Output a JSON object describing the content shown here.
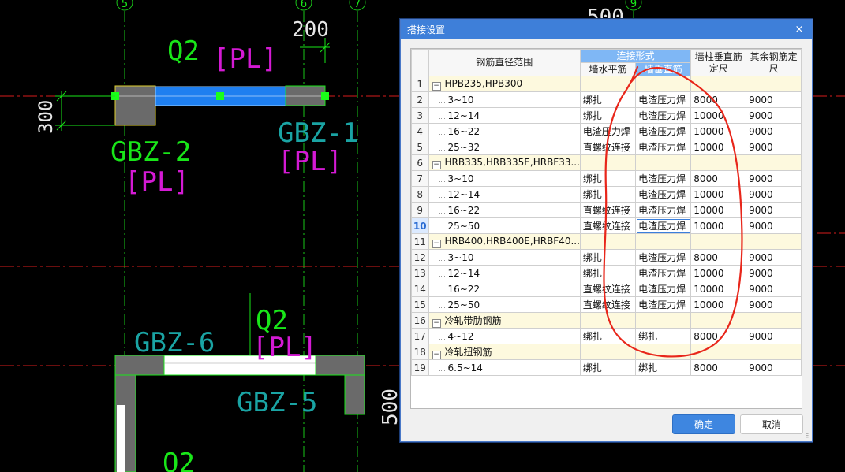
{
  "cad": {
    "axis_labels": [
      "5",
      "6",
      "7",
      "9"
    ],
    "labels": {
      "q2_top": "Q2",
      "pl_top": "[PL]",
      "dim_200": "200",
      "dim_300": "300",
      "gbz2": "GBZ-2",
      "gbz2_pl": "[PL]",
      "gbz1": "GBZ-1",
      "gbz1_pl": "[PL]",
      "dim_500_top": "500",
      "q2_mid": "Q2",
      "pl_mid": "[PL]",
      "gbz6": "GBZ-6",
      "gbz5": "GBZ-5",
      "dim_500_right": "500",
      "q2_bottom": "Q2"
    }
  },
  "dialog": {
    "title": "搭接设置",
    "close_label": "×",
    "headers": {
      "range": "钢筋直径范围",
      "connection": "连接形式",
      "wall_horizontal": "墙水平筋",
      "wall_vertical": "墙垂直筋",
      "column_length_1": "墙柱垂直筋",
      "column_length_2": "定尺",
      "other_length_1": "其余钢筋定",
      "other_length_2": "尺"
    },
    "rows": [
      {
        "n": "1",
        "type": "group",
        "range": "HPB235,HPB300",
        "h": "",
        "v": "",
        "len1": "",
        "len2": ""
      },
      {
        "n": "2",
        "type": "child",
        "range": "3~10",
        "h": "绑扎",
        "v": "电渣压力焊",
        "len1": "8000",
        "len2": "9000"
      },
      {
        "n": "3",
        "type": "child",
        "range": "12~14",
        "h": "绑扎",
        "v": "电渣压力焊",
        "len1": "10000",
        "len2": "9000"
      },
      {
        "n": "4",
        "type": "child",
        "range": "16~22",
        "h": "电渣压力焊",
        "v": "电渣压力焊",
        "len1": "10000",
        "len2": "9000"
      },
      {
        "n": "5",
        "type": "child",
        "range": "25~32",
        "h": "直螺纹连接",
        "v": "电渣压力焊",
        "len1": "10000",
        "len2": "9000"
      },
      {
        "n": "6",
        "type": "group",
        "range": "HRB335,HRB335E,HRBF33...",
        "h": "",
        "v": "",
        "len1": "",
        "len2": ""
      },
      {
        "n": "7",
        "type": "child",
        "range": "3~10",
        "h": "绑扎",
        "v": "电渣压力焊",
        "len1": "8000",
        "len2": "9000"
      },
      {
        "n": "8",
        "type": "child",
        "range": "12~14",
        "h": "绑扎",
        "v": "电渣压力焊",
        "len1": "10000",
        "len2": "9000"
      },
      {
        "n": "9",
        "type": "child",
        "range": "16~22",
        "h": "直螺纹连接",
        "v": "电渣压力焊",
        "len1": "10000",
        "len2": "9000"
      },
      {
        "n": "10",
        "type": "child",
        "range": "25~50",
        "h": "直螺纹连接",
        "v": "电渣压力焊",
        "len1": "10000",
        "len2": "9000",
        "selected": true
      },
      {
        "n": "11",
        "type": "group",
        "range": "HRB400,HRB400E,HRBF40...",
        "h": "",
        "v": "",
        "len1": "",
        "len2": ""
      },
      {
        "n": "12",
        "type": "child",
        "range": "3~10",
        "h": "绑扎",
        "v": "电渣压力焊",
        "len1": "8000",
        "len2": "9000"
      },
      {
        "n": "13",
        "type": "child",
        "range": "12~14",
        "h": "绑扎",
        "v": "电渣压力焊",
        "len1": "10000",
        "len2": "9000"
      },
      {
        "n": "14",
        "type": "child",
        "range": "16~22",
        "h": "直螺纹连接",
        "v": "电渣压力焊",
        "len1": "10000",
        "len2": "9000"
      },
      {
        "n": "15",
        "type": "child",
        "range": "25~50",
        "h": "直螺纹连接",
        "v": "电渣压力焊",
        "len1": "10000",
        "len2": "9000"
      },
      {
        "n": "16",
        "type": "group",
        "range": "冷轧带肋钢筋",
        "h": "",
        "v": "",
        "len1": "",
        "len2": ""
      },
      {
        "n": "17",
        "type": "child",
        "range": "4~12",
        "h": "绑扎",
        "v": "绑扎",
        "len1": "8000",
        "len2": "9000"
      },
      {
        "n": "18",
        "type": "group",
        "range": "冷轧扭钢筋",
        "h": "",
        "v": "",
        "len1": "",
        "len2": ""
      },
      {
        "n": "19",
        "type": "child",
        "range": "6.5~14",
        "h": "绑扎",
        "v": "绑扎",
        "len1": "8000",
        "len2": "9000"
      }
    ],
    "ok_label": "确定",
    "cancel_label": "取消",
    "expander_symbol": "−",
    "resize_grip": "⠿"
  },
  "colors": {
    "title_bar": "#3e7fd9",
    "header_highlight": "#7fb7f5",
    "group_row": "#fdf9de",
    "annotation_red": "#e8261a",
    "cad_green": "#19e619",
    "cad_magenta": "#d41ad4",
    "cad_teal": "#1aa4a4"
  }
}
